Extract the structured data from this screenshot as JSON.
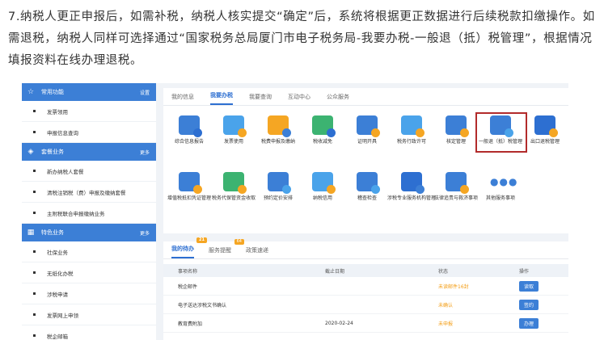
{
  "intro": "7.纳税人更正申报后，如需补税，纳税人核实提交“确定”后，系统将根据更正数据进行后续税款扣缴操作。如需退税，纳税人同样可选择通过“国家税务总局厦门市电子税务局-我要办税-一般退（抵）税管理”，根据情况填报资料在线办理退税。",
  "sidebar": {
    "sections": [
      {
        "title": "常用功能",
        "more": "设置",
        "icon": "star-icon",
        "items": [
          "发票领用",
          "申报信息查询"
        ]
      },
      {
        "title": "套餐业务",
        "more": "更多",
        "icon": "layers-icon",
        "items": [
          "新办纳税人套餐",
          "清税注销税（费）申报及缴纳套餐",
          "主附税联合申报缴纳业务"
        ]
      },
      {
        "title": "特色业务",
        "more": "更多",
        "icon": "grid-icon",
        "items": [
          "社保业务",
          "无纸化办税",
          "涉税申请",
          "发票网上申领",
          "税企邮箱"
        ]
      }
    ]
  },
  "main_tabs": [
    "我的信息",
    "我要办税",
    "我要查询",
    "互动中心",
    "公众服务"
  ],
  "icons": [
    {
      "label": "综合信息报告",
      "color": "#3c7fd6",
      "badge": "#2d6fd1"
    },
    {
      "label": "发票使用",
      "color": "#4aa3ea",
      "badge": "#f5a623"
    },
    {
      "label": "税费申报及缴纳",
      "color": "#f5a623",
      "badge": "#3c7fd6"
    },
    {
      "label": "税收减免",
      "color": "#3cb371",
      "badge": "#2d6fd1"
    },
    {
      "label": "证明开具",
      "color": "#3c7fd6",
      "badge": "#f5a623"
    },
    {
      "label": "税务行政许可",
      "color": "#4aa3ea",
      "badge": "#f5a623"
    },
    {
      "label": "核定管理",
      "color": "#3c7fd6",
      "badge": "#f5a623"
    },
    {
      "label": "一般退（抵）税管理",
      "color": "#3c7fd6",
      "badge": "#4aa3ea"
    },
    {
      "label": "出口退税管理",
      "color": "#2d6fd1",
      "badge": "#f5a623"
    },
    {
      "label": "增值税抵扣凭证管理",
      "color": "#3c7fd6",
      "badge": "#f5a623"
    },
    {
      "label": "税务代保管资金收取",
      "color": "#3cb371",
      "badge": "#f5a623"
    },
    {
      "label": "预约定价安排",
      "color": "#3c7fd6",
      "badge": "#4aa3ea"
    },
    {
      "label": "纳税信用",
      "color": "#4aa3ea",
      "badge": "#f5a623"
    },
    {
      "label": "稽查检查",
      "color": "#3c7fd6",
      "badge": "#4aa3ea"
    },
    {
      "label": "涉税专业服务机构管理",
      "color": "#2d6fd1",
      "badge": "#3c7fd6"
    },
    {
      "label": "法律追责与救济事项",
      "color": "#3c7fd6",
      "badge": "#f5a623"
    },
    {
      "label": "其他服务事项",
      "color": "#ffffff",
      "badge": "#ffffff"
    }
  ],
  "bottom_tabs": [
    {
      "label": "我的待办",
      "badge": "21"
    },
    {
      "label": "服务提醒",
      "badge": "64"
    },
    {
      "label": "政策速递",
      "badge": ""
    }
  ],
  "table": {
    "headers": [
      "事项名称",
      "截止日期",
      "状态",
      "操作"
    ],
    "rows": [
      {
        "name": "税企邮件",
        "date": "",
        "status": "未读邮件16封",
        "op": "读取"
      },
      {
        "name": "电子送达涉税文书确认",
        "date": "",
        "status": "未确认",
        "op": "签约"
      },
      {
        "name": "教育费附加",
        "date": "2020-02-24",
        "status": "未申报",
        "op": "办理"
      }
    ]
  }
}
